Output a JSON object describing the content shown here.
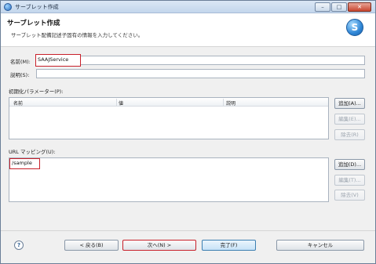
{
  "window": {
    "title": "サーブレット作成",
    "minimize": "–",
    "maximize": "□",
    "close": "✕"
  },
  "header": {
    "title": "サーブレット作成",
    "description": "サーブレット配備記述子固有の情報を入力してください。",
    "logo_letter": "S"
  },
  "form": {
    "name_label": "名前(M):",
    "name_value": "SAAJService",
    "desc_label": "説明(S):",
    "desc_value": "",
    "init_params_label": "初期化パラメーター(P):",
    "init_params_columns": [
      "名前",
      "値",
      "説明"
    ],
    "url_mapping_label": "URL マッピング(U):",
    "url_mappings": [
      "/sample"
    ]
  },
  "side_buttons": {
    "params": {
      "add": "追加(A)...",
      "edit": "編集(E)...",
      "remove": "除去(R)"
    },
    "mappings": {
      "add": "追加(D)...",
      "edit": "編集(T)...",
      "remove": "除去(V)"
    }
  },
  "footer": {
    "help": "?",
    "back": "< 戻る(B)",
    "next": "次へ(N) >",
    "finish": "完了(F)",
    "cancel": "キャンセル"
  },
  "colors": {
    "highlight": "#c8202a",
    "accent": "#2f86d6"
  }
}
